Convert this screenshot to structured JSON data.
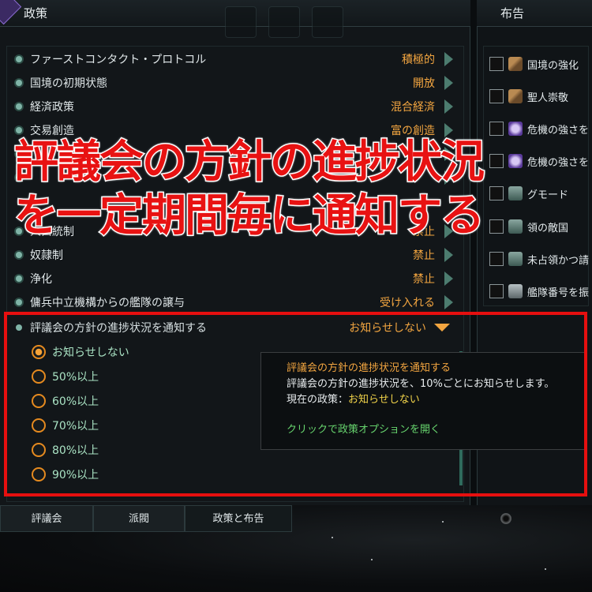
{
  "left_panel": {
    "title": "政策",
    "policies": [
      {
        "name": "ファーストコンタクト・プロトコル",
        "value": "積極的"
      },
      {
        "name": "国境の初期状態",
        "value": "開放"
      },
      {
        "name": "経済政策",
        "value": "混合経済"
      },
      {
        "name": "交易創造",
        "value": "富の創造"
      },
      {
        "name": "",
        "value": ""
      },
      {
        "name": "",
        "value": ""
      },
      {
        "name": "人口統制",
        "value": "禁止"
      },
      {
        "name": "奴隷制",
        "value": "禁止"
      },
      {
        "name": "浄化",
        "value": "禁止"
      },
      {
        "name": "傭兵中立機構からの艦隊の譲与",
        "value": "受け入れる"
      }
    ],
    "selected_policy": {
      "name": "評議会の方針の進捗状況を通知する",
      "value": "お知らせしない"
    },
    "options": [
      {
        "label": "お知らせしない",
        "selected": true
      },
      {
        "label": "50%以上",
        "selected": false
      },
      {
        "label": "60%以上",
        "selected": false
      },
      {
        "label": "70%以上",
        "selected": false
      },
      {
        "label": "80%以上",
        "selected": false
      },
      {
        "label": "90%以上",
        "selected": false
      }
    ]
  },
  "tooltip": {
    "title": "評議会の方針の進捗状況を通知する",
    "description": "評議会の方針の進捗状況を、10%ごとにお知らせします。",
    "current_label": "現在の政策：",
    "current_value": "お知らせしない",
    "action": "クリックで政策オプションを開く"
  },
  "right_panel": {
    "title": "布告",
    "edicts": [
      {
        "label": "国境の強化",
        "icon": "hammer-icon"
      },
      {
        "label": "聖人崇敬",
        "icon": "hammer-icon"
      },
      {
        "label": "危機の強さを",
        "icon": "skull-icon"
      },
      {
        "label": "危機の強さを",
        "icon": "skull-icon"
      },
      {
        "label": "グモード",
        "icon": "figure-icon"
      },
      {
        "label": "領の敵国",
        "icon": "figure-icon"
      },
      {
        "label": "未占領かつ請",
        "icon": "figure-icon"
      },
      {
        "label": "艦隊番号を振",
        "icon": "ship-icon"
      }
    ]
  },
  "bottom_tabs": [
    {
      "label": "評議会"
    },
    {
      "label": "派閥"
    },
    {
      "label": "政策と布告"
    }
  ],
  "overlay_caption": {
    "line1": "評議会の方針の進捗状況",
    "line2": "を一定期間毎に通知する"
  },
  "colors": {
    "accent": "#f2a540",
    "option_text": "#a9e2c3",
    "highlight_frame": "#e60f0f",
    "action_text": "#67d46e"
  }
}
